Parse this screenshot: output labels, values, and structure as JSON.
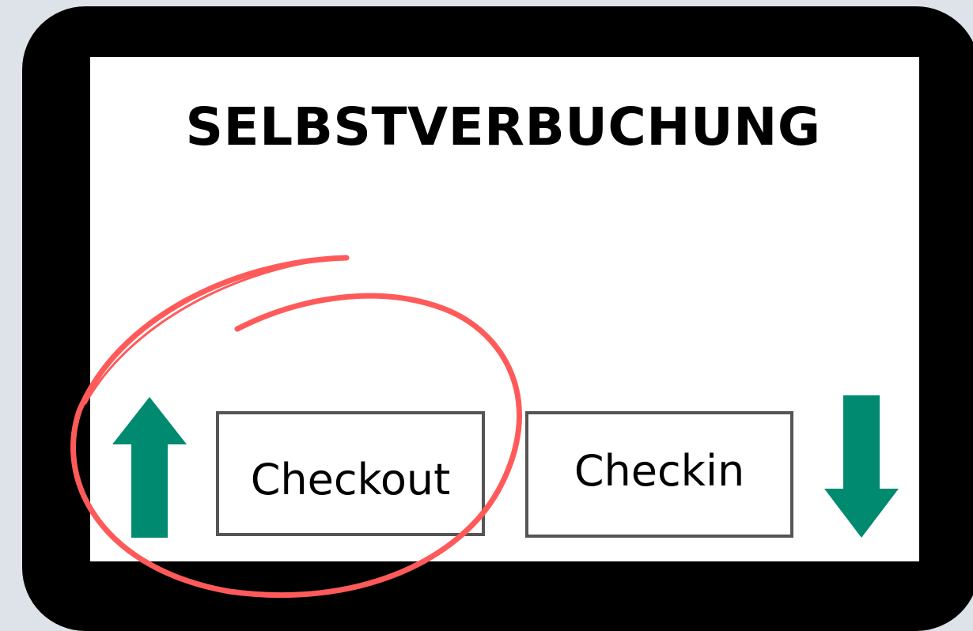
{
  "title": "SELBSTVERBUCHUNG",
  "buttons": {
    "checkout_label": "Checkout",
    "checkin_label": "Checkin"
  },
  "icons": {
    "checkout_arrow": "arrow-up-icon",
    "checkin_arrow": "arrow-down-icon",
    "highlight": "circle-annotation"
  },
  "colors": {
    "background": "#dde3e8",
    "device_frame": "#000000",
    "screen": "#ffffff",
    "arrow": "#008a70",
    "highlight": "#ff5a5a",
    "button_border": "#555555"
  }
}
